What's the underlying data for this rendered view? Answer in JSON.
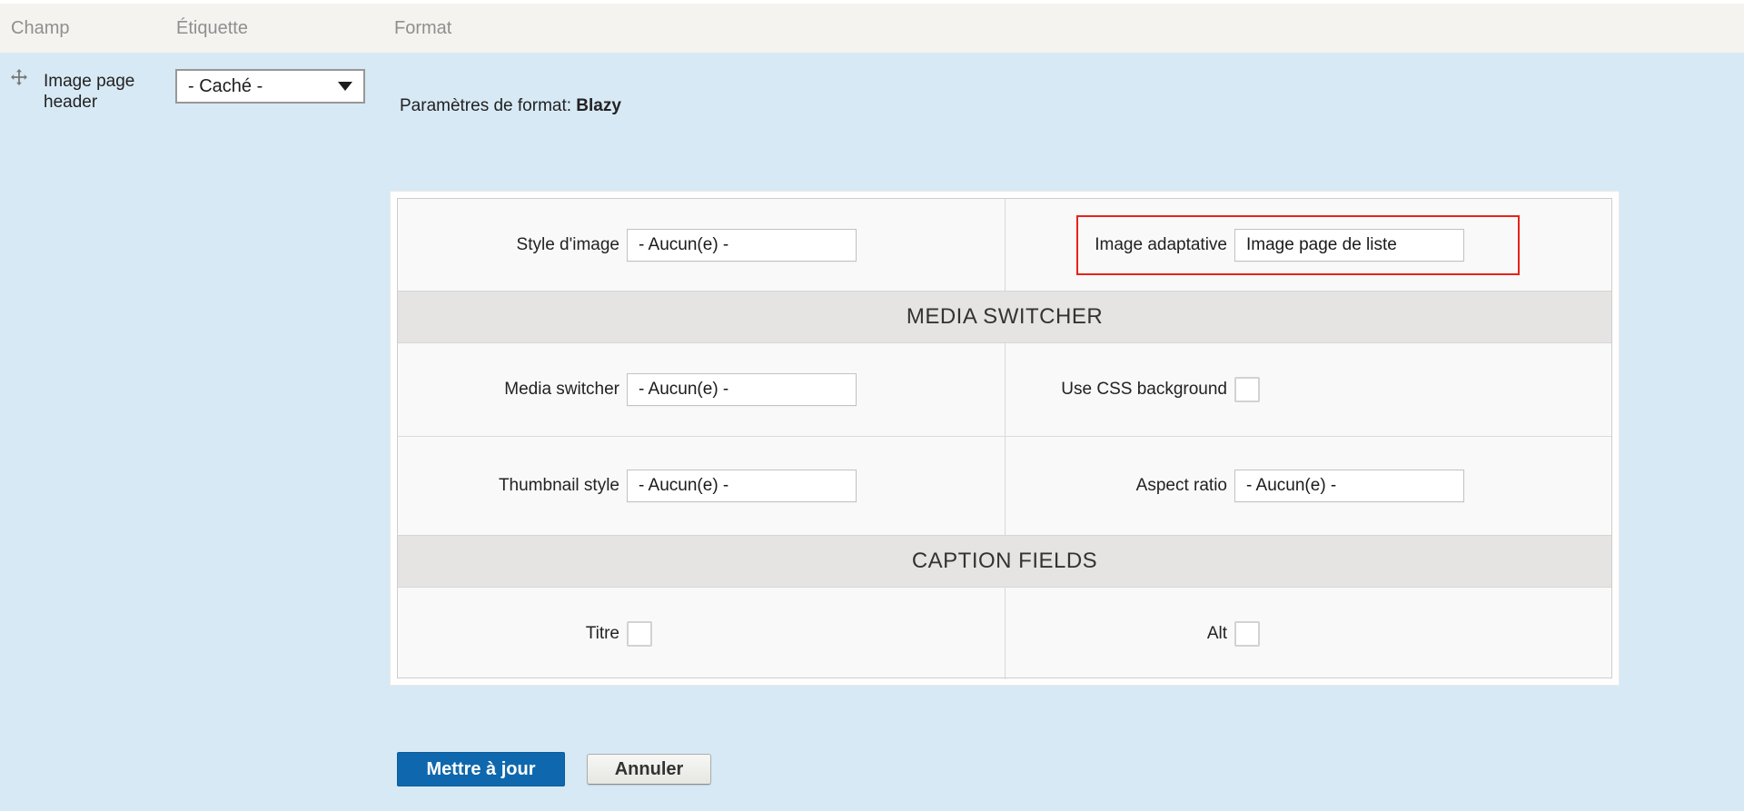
{
  "header": {
    "columns": [
      {
        "label": "Champ"
      },
      {
        "label": "Étiquette"
      },
      {
        "label": "Format"
      }
    ]
  },
  "row": {
    "field_name": "Image page header",
    "label_value": "- Caché -",
    "format_summary_prefix": "Paramètres de format: ",
    "format_name": "Blazy"
  },
  "settings": {
    "rows": [
      {
        "type": "fields",
        "left": {
          "label": "Style d'image",
          "control": "select",
          "value": "- Aucun(e) -"
        },
        "right": {
          "label": "Image adaptative",
          "control": "select",
          "value": "Image page de liste",
          "highlighted": true
        }
      },
      {
        "type": "section",
        "label": "MEDIA SWITCHER"
      },
      {
        "type": "fields",
        "left": {
          "label": "Media switcher",
          "control": "select",
          "value": "- Aucun(e) -"
        },
        "right": {
          "label": "Use CSS background",
          "control": "checkbox",
          "checked": false
        }
      },
      {
        "type": "fields",
        "left": {
          "label": "Thumbnail style",
          "control": "select",
          "value": "- Aucun(e) -"
        },
        "right": {
          "label": "Aspect ratio",
          "control": "select",
          "value": "- Aucun(e) -"
        }
      },
      {
        "type": "section",
        "label": "CAPTION FIELDS"
      },
      {
        "type": "fields",
        "left": {
          "label": "Titre",
          "control": "checkbox",
          "checked": false
        },
        "right": {
          "label": "Alt",
          "control": "checkbox",
          "checked": false
        }
      }
    ],
    "update_button": "Mettre à jour",
    "cancel_button": "Annuler"
  },
  "icons": {
    "drag_handle": "move-cross-icon",
    "label_select_caret": "chevron-down-icon"
  },
  "colors": {
    "row_highlight": "#d7e9f5",
    "header_band": "#f5f3f0",
    "section_band": "#e5e4e3",
    "highlight_border": "#e8221a",
    "primary_button": "#0f68ad"
  }
}
